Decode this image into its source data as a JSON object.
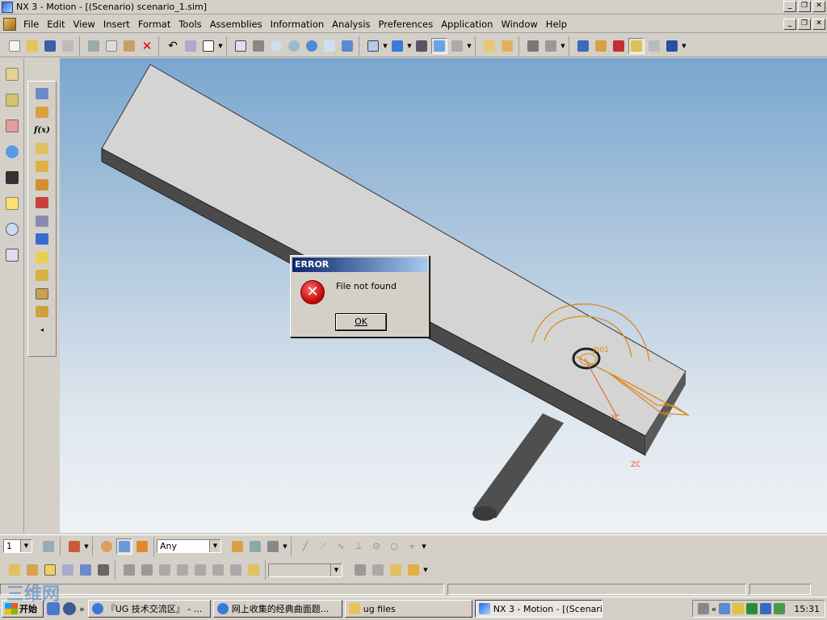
{
  "window": {
    "title": "NX 3 - Motion - [(Scenario) scenario_1.sim]",
    "controls": [
      "_",
      "❐",
      "✕"
    ]
  },
  "menu": {
    "items": [
      "File",
      "Edit",
      "View",
      "Insert",
      "Format",
      "Tools",
      "Assemblies",
      "Information",
      "Analysis",
      "Preferences",
      "Application",
      "Window",
      "Help"
    ]
  },
  "vtoolbar": {
    "fx_label": "f(x)"
  },
  "viewport": {
    "labels": {
      "motion_label": "J001",
      "xc": "XC",
      "yc": "YC",
      "zc": "ZC"
    },
    "colors": {
      "top_face": "#d4d4d4",
      "side_face": "#4a4a4a",
      "cylinder": "#505050",
      "wireframe": "#d98a1e",
      "triad": "#e25a1c"
    }
  },
  "dialog": {
    "title": "ERROR",
    "message": "File not found",
    "ok_label": "OK",
    "icon": "error-icon"
  },
  "toolbar2": {
    "layer_value": "1",
    "filter_value": "Any"
  },
  "taskbar": {
    "start_label": "开始",
    "tasks": [
      {
        "label": "『UG 技术交流区』 - ...",
        "icon": "browser-icon"
      },
      {
        "label": "网上收集的经典曲面题...",
        "icon": "browser-icon"
      },
      {
        "label": "ug files",
        "icon": "folder-icon"
      },
      {
        "label": "NX 3 - Motion - [(Scenari...",
        "icon": "nx-icon"
      }
    ],
    "clock": "15:31"
  },
  "watermark": "三维网"
}
